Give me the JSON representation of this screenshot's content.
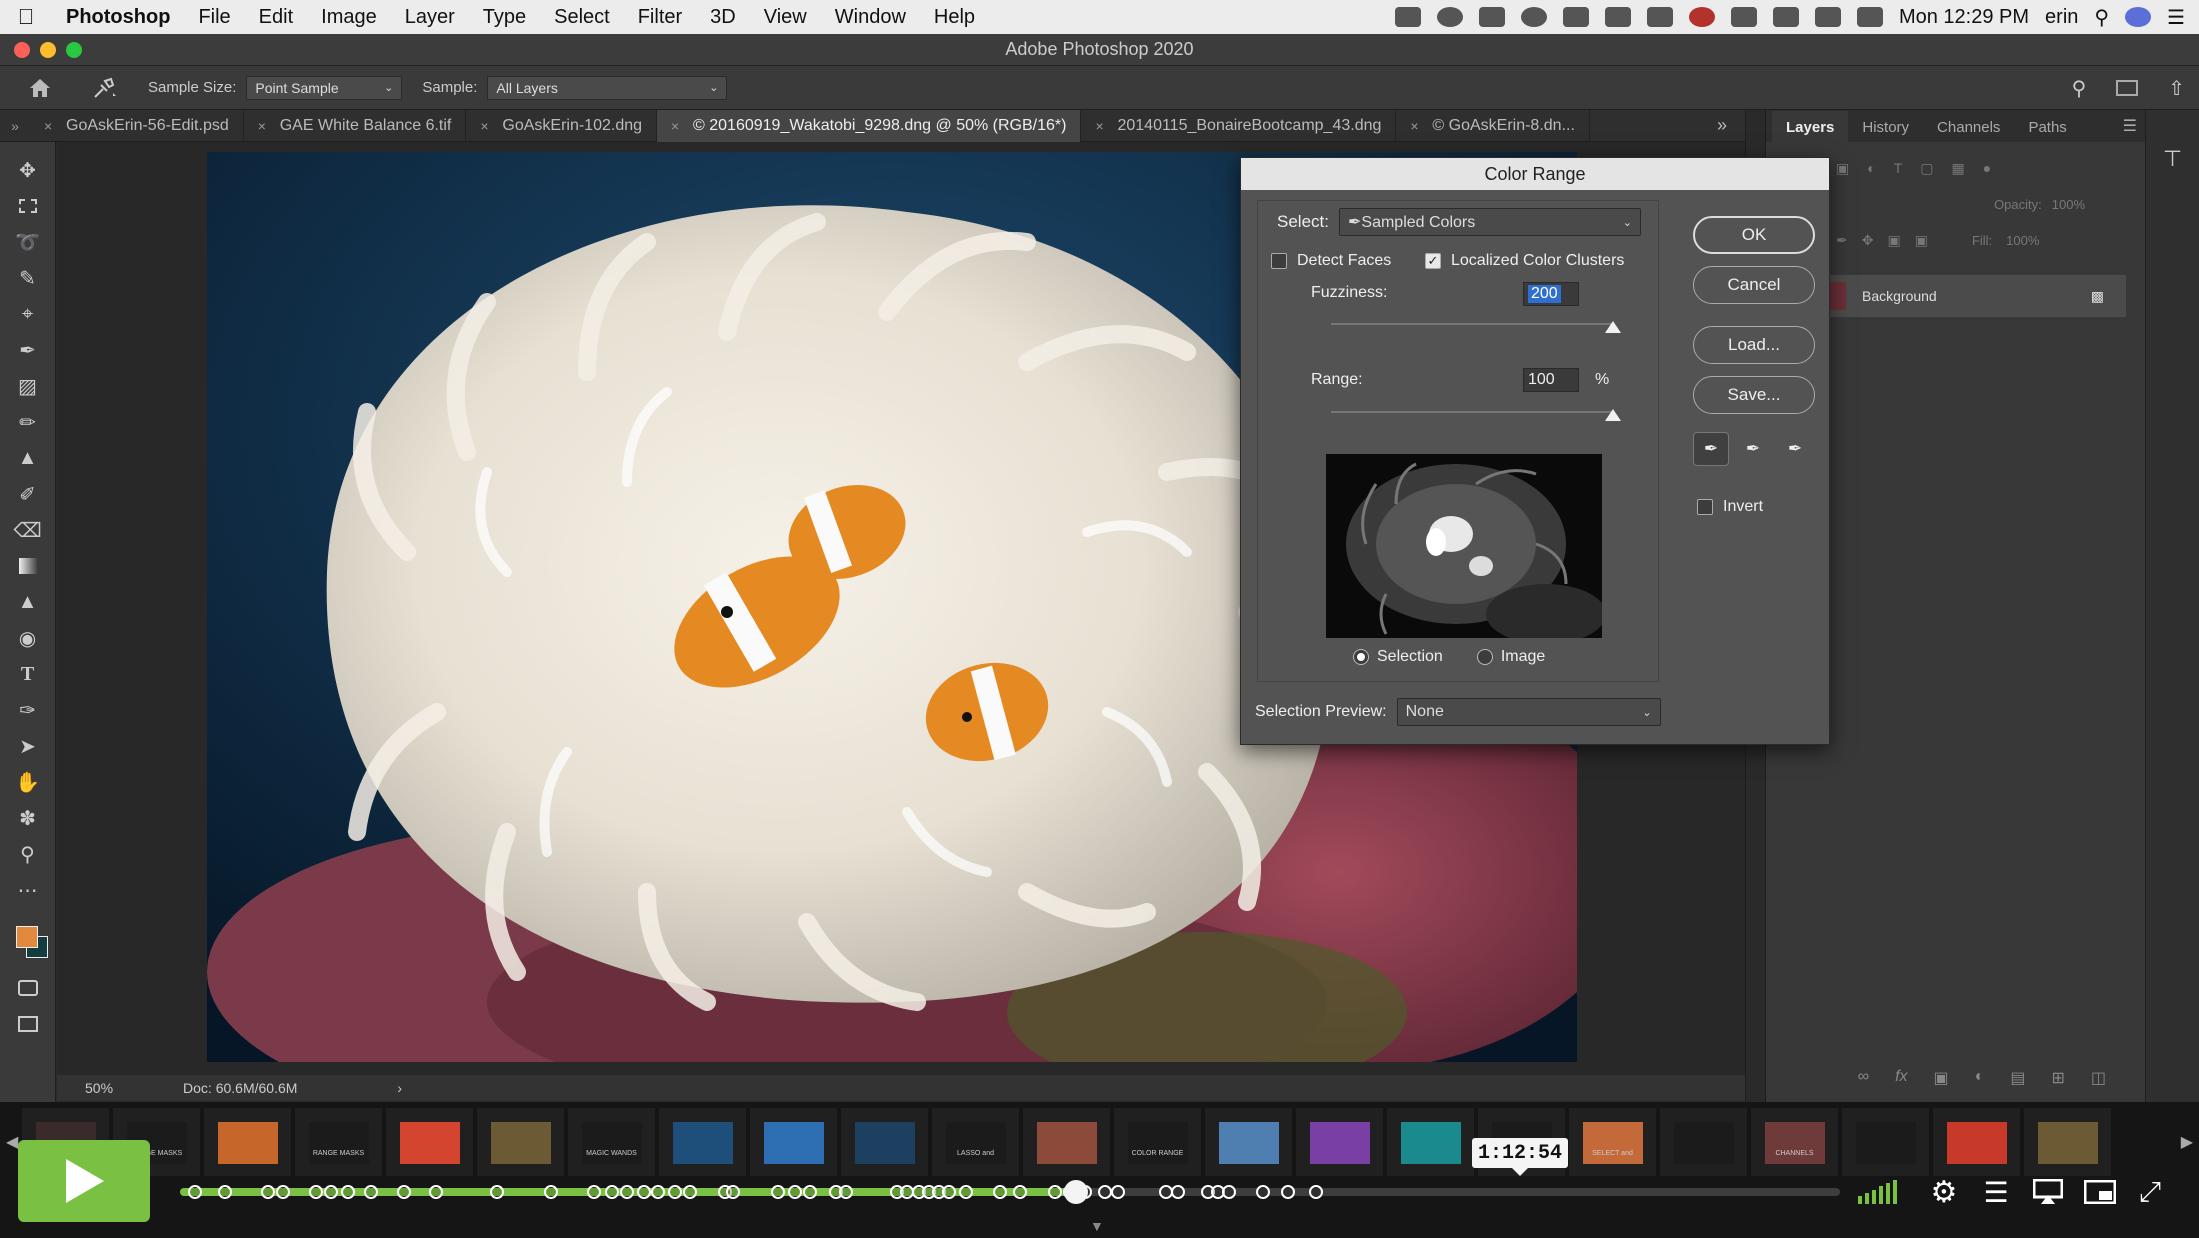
{
  "menubar": {
    "app_name": "Photoshop",
    "items": [
      "File",
      "Edit",
      "Image",
      "Layer",
      "Type",
      "Select",
      "Filter",
      "3D",
      "View",
      "Window",
      "Help"
    ],
    "clock": "Mon 12:29 PM",
    "user": "erin"
  },
  "window": {
    "title": "Adobe Photoshop 2020"
  },
  "options_bar": {
    "sample_size_label": "Sample Size:",
    "sample_size_value": "Point Sample",
    "sample_label": "Sample:",
    "sample_value": "All Layers"
  },
  "tabs": [
    {
      "label": "GoAskErin-56-Edit.psd",
      "active": false
    },
    {
      "label": "GAE White Balance 6.tif",
      "active": false
    },
    {
      "label": "GoAskErin-102.dng",
      "active": false
    },
    {
      "label": "© 20160919_Wakatobi_9298.dng @ 50% (RGB/16*)",
      "active": true
    },
    {
      "label": "20140115_BonaireBootcamp_43.dng",
      "active": false
    },
    {
      "label": "© GoAskErin-8.dn...",
      "active": false
    }
  ],
  "status_bar": {
    "zoom": "50%",
    "doc": "Doc: 60.6M/60.6M",
    "chevron": "›"
  },
  "layers_panel": {
    "tabs": [
      "Layers",
      "History",
      "Channels",
      "Paths"
    ],
    "opacity_label": "Opacity:",
    "opacity_value": "100%",
    "fill_label": "Fill:",
    "fill_value": "100%",
    "layer_name": "Background"
  },
  "color_range": {
    "title": "Color Range",
    "select_label": "Select:",
    "select_value": "Sampled Colors",
    "detect_faces_label": "Detect Faces",
    "detect_faces_checked": false,
    "localized_label": "Localized Color Clusters",
    "localized_checked": true,
    "fuzziness_label": "Fuzziness:",
    "fuzziness_value": "200",
    "fuzziness_level": 1.0,
    "range_label": "Range:",
    "range_value": "100",
    "range_unit": "%",
    "range_level": 1.0,
    "selection_radio_label": "Selection",
    "image_radio_label": "Image",
    "selection_preview_label": "Selection Preview:",
    "selection_preview_value": "None",
    "ok_label": "OK",
    "cancel_label": "Cancel",
    "load_label": "Load...",
    "save_label": "Save...",
    "invert_label": "Invert"
  },
  "player": {
    "current_time": "1:12:54",
    "progress": 0.54,
    "thumb_captions": [
      "",
      "RANGE MASKS",
      "",
      "RANGE MASKS",
      "",
      "",
      "MAGIC WANDS",
      "",
      "",
      "",
      "LASSO and",
      "",
      "COLOR RANGE",
      "",
      "",
      "",
      "",
      "SELECT and",
      "",
      "CHANNELS",
      "",
      ""
    ]
  },
  "colors": {
    "accent_green": "#7ac143",
    "foreground_swatch": "#e2893e",
    "background_swatch": "#143d3f"
  }
}
